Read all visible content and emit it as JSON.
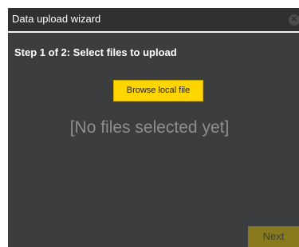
{
  "dialog": {
    "title": "Data upload wizard",
    "close_icon": "close-icon",
    "step_title": "Step 1 of 2: Select files to upload",
    "browse_label": "Browse local file",
    "empty_message": "[No files selected yet]",
    "next_label": "Next"
  },
  "colors": {
    "accent": "#ffd500",
    "dialog_background": "#3b3d3e",
    "titlebar_background": "#2e3031",
    "next_disabled": "#8a7a1e"
  }
}
